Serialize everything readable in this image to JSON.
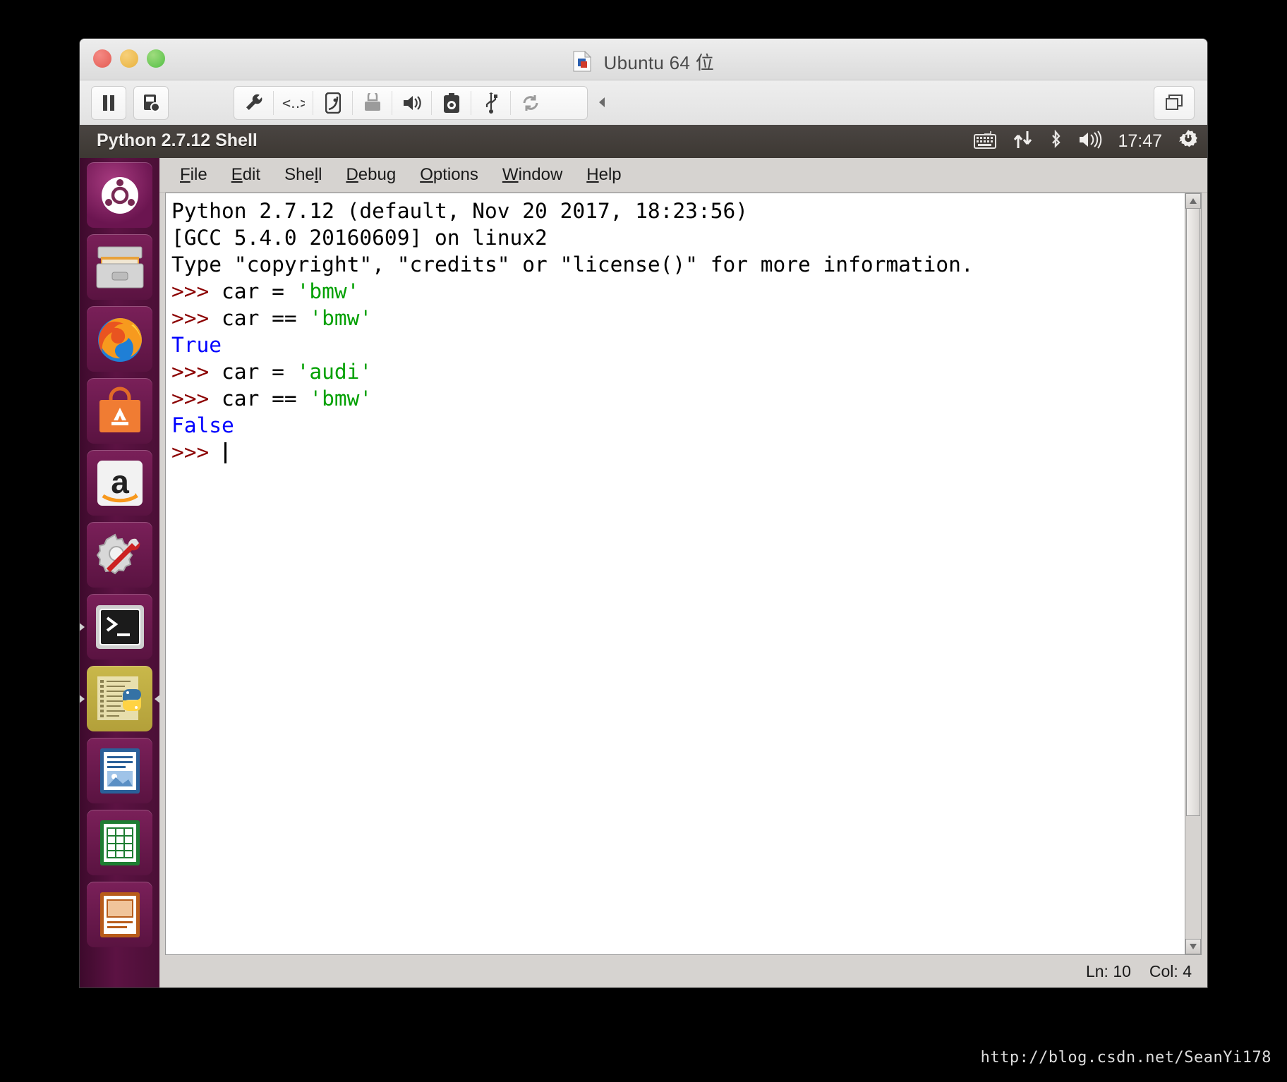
{
  "vmware": {
    "title": "Ubuntu 64 位",
    "title_icon": "vm-document-icon",
    "traffic_lights": [
      "close-button",
      "minimize-button",
      "zoom-button"
    ],
    "toolbar": {
      "pause_label": "pause-icon",
      "snapshot_label": "snapshot-icon",
      "devices": [
        "settings-wrench-icon",
        "network-icon",
        "harddisk-icon",
        "printer-icon",
        "sound-icon",
        "camera-icon",
        "usb-icon",
        "sync-icon"
      ],
      "collapse_label": "collapse-arrow-icon",
      "unity_label": "unity-view-icon"
    }
  },
  "ubuntu_panel": {
    "window_title": "Python 2.7.12 Shell",
    "indicators": [
      "keyboard-icon",
      "network-updown-icon",
      "bluetooth-icon",
      "volume-icon"
    ],
    "clock": "17:47",
    "session_icon": "power-gear-icon"
  },
  "launcher": {
    "items": [
      {
        "name": "ubuntu-dash",
        "icon": "ubuntu-logo-icon",
        "running": false,
        "focused": false
      },
      {
        "name": "files",
        "icon": "file-cabinet-icon",
        "running": false,
        "focused": false
      },
      {
        "name": "firefox",
        "icon": "firefox-icon",
        "running": false,
        "focused": false
      },
      {
        "name": "ubuntu-software",
        "icon": "software-bag-icon",
        "running": false,
        "focused": false
      },
      {
        "name": "amazon",
        "icon": "amazon-a-icon",
        "running": false,
        "focused": false
      },
      {
        "name": "system-settings",
        "icon": "gear-wrench-icon",
        "running": false,
        "focused": false
      },
      {
        "name": "terminal",
        "icon": "terminal-icon",
        "running": true,
        "focused": false
      },
      {
        "name": "idle-python",
        "icon": "python-idle-icon",
        "running": true,
        "focused": true
      },
      {
        "name": "libreoffice-writer",
        "icon": "writer-doc-icon",
        "running": false,
        "focused": false
      },
      {
        "name": "libreoffice-calc",
        "icon": "calc-doc-icon",
        "running": false,
        "focused": false
      },
      {
        "name": "libreoffice-impress",
        "icon": "impress-doc-icon",
        "running": false,
        "focused": false
      }
    ]
  },
  "idle": {
    "menu": [
      {
        "label": "File",
        "mnemonic": "F"
      },
      {
        "label": "Edit",
        "mnemonic": "E"
      },
      {
        "label": "Shell",
        "mnemonic": "l"
      },
      {
        "label": "Debug",
        "mnemonic": "D"
      },
      {
        "label": "Options",
        "mnemonic": "O"
      },
      {
        "label": "Window",
        "mnemonic": "W"
      },
      {
        "label": "Help",
        "mnemonic": "H"
      }
    ],
    "shell_lines": [
      [
        {
          "t": "Python 2.7.12 (default, Nov 20 2017, 18:23:56)",
          "c": "plain"
        }
      ],
      [
        {
          "t": "[GCC 5.4.0 20160609] on linux2",
          "c": "plain"
        }
      ],
      [
        {
          "t": "Type \"copyright\", \"credits\" or \"license()\" for more information.",
          "c": "plain"
        }
      ],
      [
        {
          "t": ">>> ",
          "c": "prompt"
        },
        {
          "t": "car = ",
          "c": "plain"
        },
        {
          "t": "'bmw'",
          "c": "string"
        }
      ],
      [
        {
          "t": ">>> ",
          "c": "prompt"
        },
        {
          "t": "car == ",
          "c": "plain"
        },
        {
          "t": "'bmw'",
          "c": "string"
        }
      ],
      [
        {
          "t": "True",
          "c": "keyword"
        }
      ],
      [
        {
          "t": ">>> ",
          "c": "prompt"
        },
        {
          "t": "car = ",
          "c": "plain"
        },
        {
          "t": "'audi'",
          "c": "string"
        }
      ],
      [
        {
          "t": ">>> ",
          "c": "prompt"
        },
        {
          "t": "car == ",
          "c": "plain"
        },
        {
          "t": "'bmw'",
          "c": "string"
        }
      ],
      [
        {
          "t": "False",
          "c": "keyword"
        }
      ],
      [
        {
          "t": ">>> ",
          "c": "prompt"
        },
        {
          "t": "",
          "c": "cursor"
        }
      ]
    ],
    "status": {
      "line": "Ln: 10",
      "column": "Col: 4"
    },
    "colors": {
      "prompt": "#8b0000",
      "string": "#00a000",
      "keyword": "#0000ff",
      "plain": "#000000"
    }
  },
  "watermark": "http://blog.csdn.net/SeanYi178"
}
